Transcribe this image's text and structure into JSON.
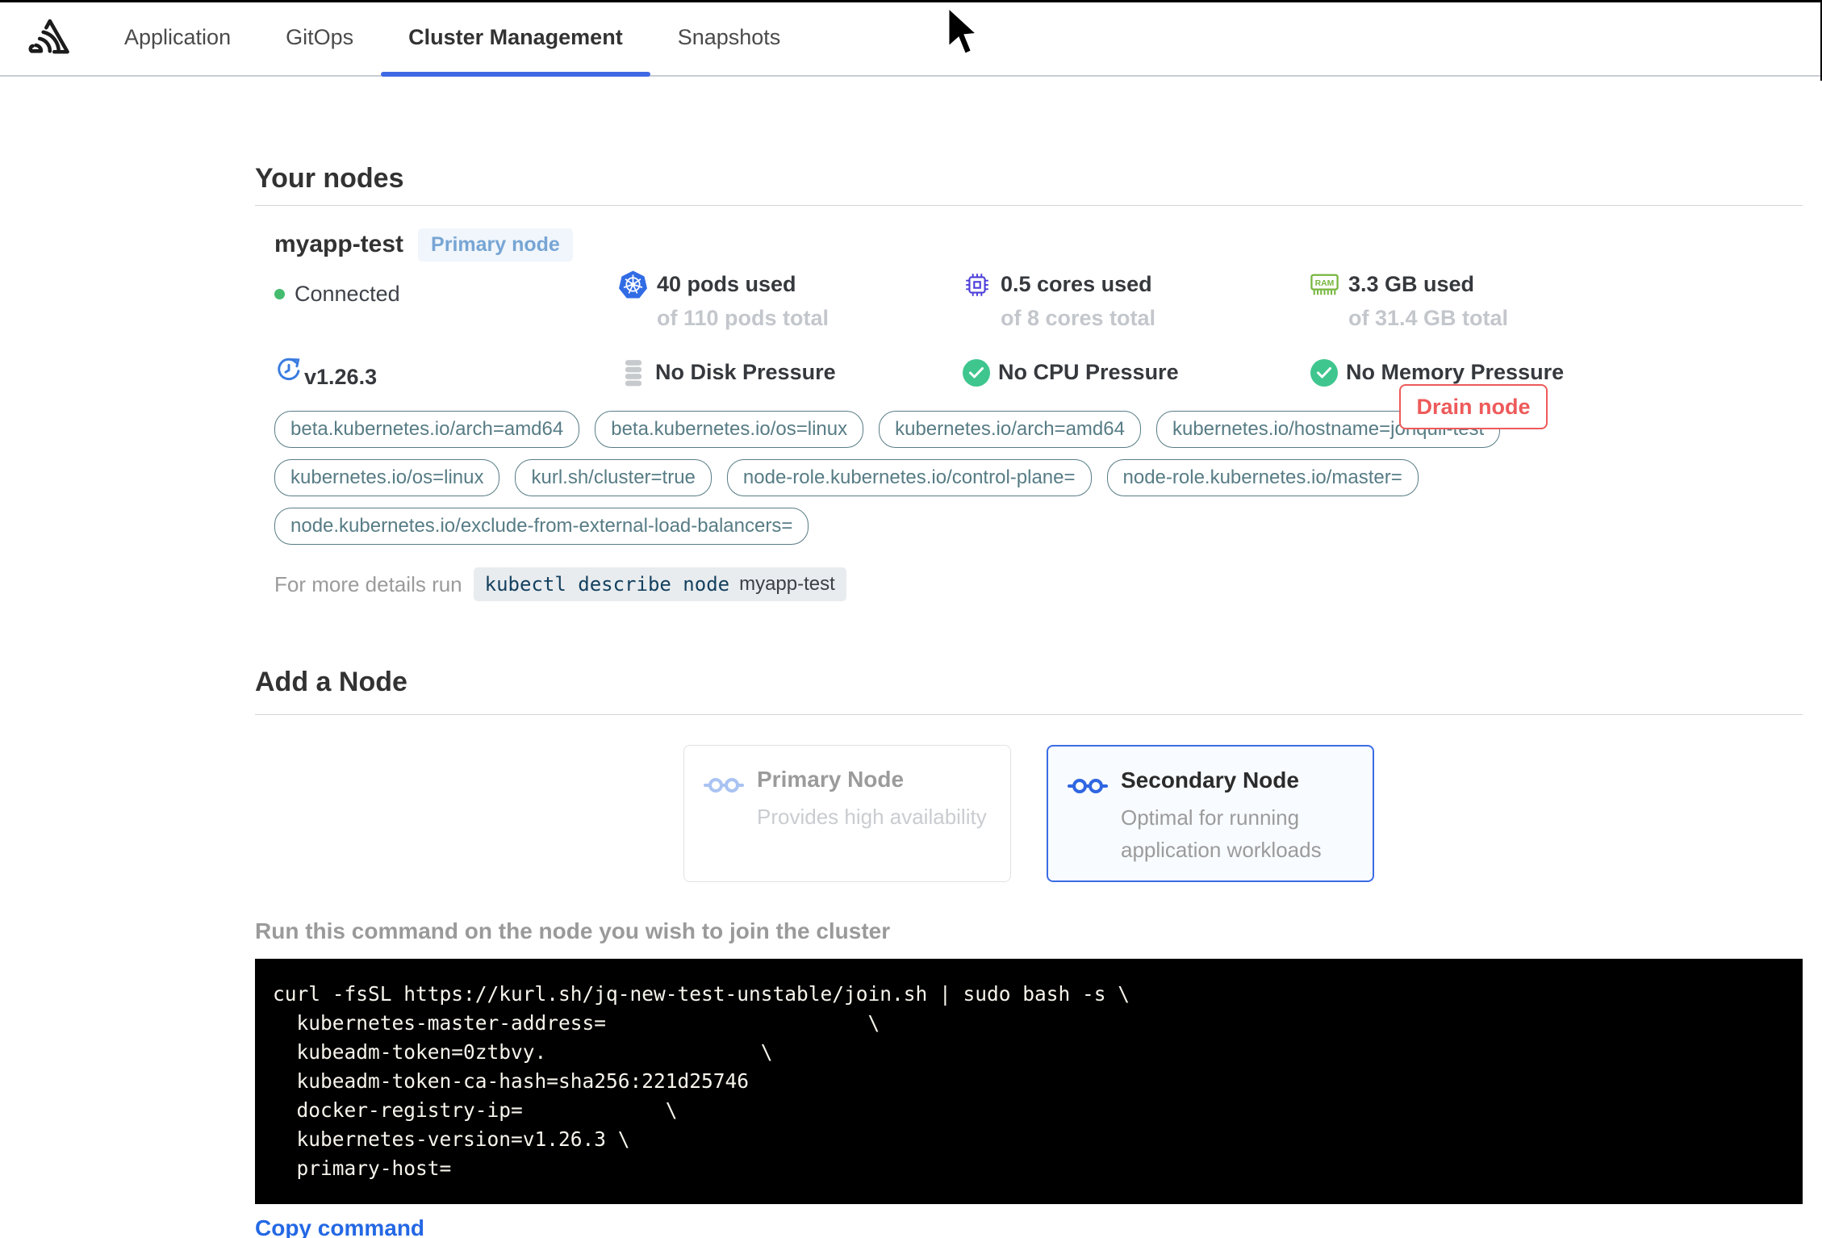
{
  "nav": {
    "logo_name": "app-logo",
    "tabs": [
      {
        "label": "Application"
      },
      {
        "label": "GitOps"
      },
      {
        "label": "Cluster Management"
      },
      {
        "label": "Snapshots"
      }
    ],
    "active_tab": "Cluster Management"
  },
  "your_nodes": {
    "title": "Your nodes",
    "node": {
      "name": "myapp-test",
      "badge": "Primary node",
      "status": "Connected",
      "version": "v1.26.3",
      "stats": [
        {
          "icon": "kubernetes-pods-icon",
          "value": "40 pods used",
          "total": "of 110 pods total"
        },
        {
          "icon": "cpu-icon",
          "value": "0.5 cores used",
          "total": "of 8 cores total"
        },
        {
          "icon": "ram-icon",
          "value": "3.3 GB used",
          "total": "of 31.4 GB total"
        }
      ],
      "conditions": [
        {
          "icon": "disk-icon",
          "label": "No Disk Pressure"
        },
        {
          "icon": "check-icon",
          "label": "No CPU Pressure"
        },
        {
          "icon": "check-icon",
          "label": "No Memory Pressure"
        }
      ],
      "labels": [
        "beta.kubernetes.io/arch=amd64",
        "beta.kubernetes.io/os=linux",
        "kubernetes.io/arch=amd64",
        "kubernetes.io/hostname=jonquil-test",
        "kubernetes.io/os=linux",
        "kurl.sh/cluster=true",
        "node-role.kubernetes.io/control-plane=",
        "node-role.kubernetes.io/master=",
        "node.kubernetes.io/exclude-from-external-load-balancers="
      ],
      "details_hint": "For more details run",
      "details_command": "kubectl describe node",
      "details_command_arg": "myapp-test",
      "drain_button": "Drain node"
    }
  },
  "add_node": {
    "title": "Add a Node",
    "options": [
      {
        "title": "Primary Node",
        "description": "Provides high availability",
        "selected": false
      },
      {
        "title": "Secondary Node",
        "description": "Optimal for running application workloads",
        "selected": true
      }
    ],
    "instruction": "Run this command on the node you wish to join the cluster",
    "command": "curl -fsSL https://kurl.sh/jq-new-test-unstable/join.sh | sudo bash -s \\\n  kubernetes-master-address=                      \\\n  kubeadm-token=0ztbvy.                  \\\n  kubeadm-token-ca-hash=sha256:221d25746\n  docker-registry-ip=            \\\n  kubernetes-version=v1.26.3 \\\n  primary-host=",
    "copy_link": "Copy command"
  },
  "colors": {
    "accent_blue": "#3b6ce5",
    "link_blue": "#2468e4",
    "badge_blue": "#77a5d4",
    "tag_teal": "#577c85",
    "danger_red": "#ee5a5a",
    "success_green": "#3fc68f",
    "kubernetes_blue": "#326ce5",
    "cpu_indigo": "#4c3ed9",
    "ram_green": "#77b63e",
    "terminal_bg": "#000000"
  }
}
